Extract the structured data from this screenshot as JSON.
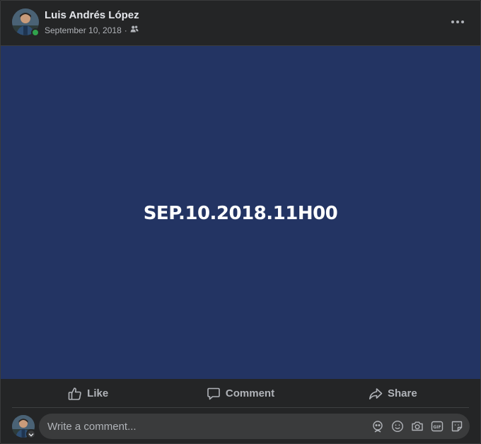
{
  "post": {
    "author_name": "Luis Andrés López",
    "date": "September 10, 2018",
    "separator": "·",
    "audience_icon": "friends-icon",
    "more_icon": "more-horizontal-icon",
    "online": true
  },
  "media": {
    "text": "SEP.10.2018.11H00",
    "background_color": "#233463",
    "text_color": "#ffffff"
  },
  "actions": {
    "like_label": "Like",
    "comment_label": "Comment",
    "share_label": "Share"
  },
  "comment": {
    "placeholder": "Write a comment...",
    "icons": [
      "avatar-sticker-icon",
      "emoji-icon",
      "camera-icon",
      "gif-icon",
      "sticker-icon"
    ]
  },
  "colors": {
    "card_background": "#242526",
    "secondary_text": "#b0b3b8",
    "primary_text": "#e4e6eb",
    "online_green": "#31a24c"
  }
}
